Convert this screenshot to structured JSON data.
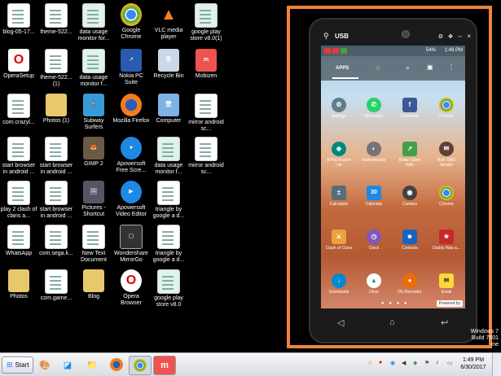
{
  "desktop": {
    "icons": [
      {
        "label": "blog-05-17..."
      },
      {
        "label": "theme-522..."
      },
      {
        "label": "data usage monitor for..."
      },
      {
        "label": "Google Chrome"
      },
      {
        "label": "VLC media player"
      },
      {
        "label": "google play store v8.0(1)"
      },
      {
        "label": "OperaSetup"
      },
      {
        "label": "theme-522... (1)"
      },
      {
        "label": "data usage monitor f..."
      },
      {
        "label": "Nokia PC Suite"
      },
      {
        "label": "Recycle Bin"
      },
      {
        "label": "Mobizen"
      },
      {
        "label": "com.crazyl..."
      },
      {
        "label": "Photos (1)"
      },
      {
        "label": "Subway Surfers"
      },
      {
        "label": "Mozilla Firefox"
      },
      {
        "label": "Computer"
      },
      {
        "label": "mirror android sc..."
      },
      {
        "label": "start browser in android ..."
      },
      {
        "label": "start browser in android ..."
      },
      {
        "label": "GIMP 2"
      },
      {
        "label": "Apowersoft Free Scre..."
      },
      {
        "label": "data usage monitor f..."
      },
      {
        "label": "mirror android sc..."
      },
      {
        "label": "play 2 clash of clans a..."
      },
      {
        "label": "start browser in android ..."
      },
      {
        "label": "Pictures - Shortcut"
      },
      {
        "label": "Apowersoft Video Editor"
      },
      {
        "label": "triangle by google a d..."
      },
      {
        "label": "WhatsApp"
      },
      {
        "label": "com.sega.k..."
      },
      {
        "label": "New Text Document"
      },
      {
        "label": "Wondershare MirrorGo"
      },
      {
        "label": "triangle by google a d..."
      },
      {
        "label": "Photos"
      },
      {
        "label": "com.game..."
      },
      {
        "label": "Blog"
      },
      {
        "label": "Opera Browser"
      },
      {
        "label": "google play store v8.0"
      }
    ]
  },
  "phone": {
    "usb_label": "USB",
    "status_time": "1:49 PM",
    "battery": "54%",
    "tab_apps": "APPS",
    "apps": [
      {
        "label": "Settings"
      },
      {
        "label": "WhatsApp"
      },
      {
        "label": "Facebook"
      },
      {
        "label": "Chrome"
      },
      {
        "label": "APKExtractor Lite"
      },
      {
        "label": "Authenticator"
      },
      {
        "label": "Better Open With"
      },
      {
        "label": "Bulk SMS Sender"
      },
      {
        "label": "Calculator"
      },
      {
        "label": "Calendar"
      },
      {
        "label": "Camera"
      },
      {
        "label": "Chrome"
      },
      {
        "label": "Clash of Clans"
      },
      {
        "label": "Clock"
      },
      {
        "label": "Contacts"
      },
      {
        "label": "Daddy Was a..."
      },
      {
        "label": "Downloads"
      },
      {
        "label": "Drive"
      },
      {
        "label": "DU Recorder"
      },
      {
        "label": "Email"
      }
    ],
    "powered_by": "Powered by",
    "calendar_day": "30",
    "nav_back": "◁",
    "nav_home": "⌂",
    "nav_recent": "↩"
  },
  "watermark": {
    "line1": "Windows 7",
    "line2": "Build 7601",
    "line3": "ine"
  },
  "taskbar": {
    "start_label": "Start",
    "time": "1:49 PM",
    "date": "6/30/2017"
  }
}
